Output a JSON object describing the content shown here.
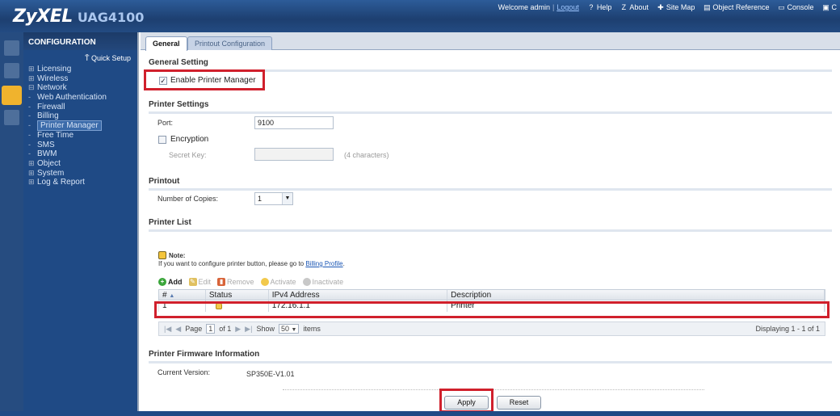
{
  "header": {
    "brand": "ZyXEL",
    "model": "UAG4100",
    "welcome": "Welcome admin",
    "logout": "Logout",
    "links": [
      {
        "label": "Help",
        "icon": "help-icon",
        "glyph": "?"
      },
      {
        "label": "About",
        "icon": "about-icon",
        "glyph": "Z"
      },
      {
        "label": "Site Map",
        "icon": "sitemap-icon",
        "glyph": "✚"
      },
      {
        "label": "Object Reference",
        "icon": "object-reference-icon",
        "glyph": "▤"
      },
      {
        "label": "Console",
        "icon": "console-icon",
        "glyph": "▭"
      },
      {
        "label": "C",
        "icon": "cli-icon",
        "glyph": "▣"
      }
    ]
  },
  "sidebar": {
    "title": "CONFIGURATION",
    "quick_setup": "Quick Setup",
    "items": [
      {
        "marker": "⊞",
        "label": "Licensing"
      },
      {
        "marker": "⊞",
        "label": "Wireless"
      },
      {
        "marker": "⊟",
        "label": "Network"
      },
      {
        "marker": "-",
        "label": "Web Authentication"
      },
      {
        "marker": "-",
        "label": "Firewall"
      },
      {
        "marker": "-",
        "label": "Billing"
      },
      {
        "marker": "-",
        "label": "Printer Manager"
      },
      {
        "marker": "-",
        "label": "Free Time"
      },
      {
        "marker": "-",
        "label": "SMS"
      },
      {
        "marker": "-",
        "label": "BWM"
      },
      {
        "marker": "⊞",
        "label": "Object"
      },
      {
        "marker": "⊞",
        "label": "System"
      },
      {
        "marker": "⊞",
        "label": "Log & Report"
      }
    ]
  },
  "tabs": {
    "general": "General",
    "printout": "Printout Configuration"
  },
  "general_setting": {
    "title": "General Setting",
    "enable_label": "Enable Printer Manager",
    "enable_checked": "✓"
  },
  "printer_settings": {
    "title": "Printer Settings",
    "port_label": "Port:",
    "port_value": "9100",
    "encryption_label": "Encryption",
    "secret_label": "Secret Key:",
    "secret_hint": "(4 characters)"
  },
  "printout": {
    "title": "Printout",
    "copies_label": "Number of Copies:",
    "copies_value": "1"
  },
  "printer_list": {
    "title": "Printer List",
    "note_title": "Note:",
    "note_text": "If you want to configure printer button, please go to",
    "note_link": "Billing Profile",
    "note_end": ".",
    "toolbar": {
      "add": "Add",
      "edit": "Edit",
      "remove": "Remove",
      "activate": "Activate",
      "inactivate": "Inactivate"
    },
    "columns": [
      "#",
      "Status",
      "IPv4 Address",
      "Description"
    ],
    "sort_marker": "▲",
    "rows": [
      {
        "num": "1",
        "ip": "172.16.1.1",
        "description": "Printer"
      }
    ],
    "pager": {
      "page_label": "Page",
      "page_value": "1",
      "of_label": "of 1",
      "show_label": "Show",
      "show_value": "50",
      "items_label": "items",
      "displaying": "Displaying 1 - 1 of 1"
    }
  },
  "firmware": {
    "title": "Printer Firmware Information",
    "version_label": "Current Version:",
    "version_value": "SP350E-V1.01"
  },
  "buttons": {
    "apply": "Apply",
    "reset": "Reset"
  },
  "colors": {
    "highlight": "#d0202c",
    "brand_blue": "#1f4a85"
  }
}
